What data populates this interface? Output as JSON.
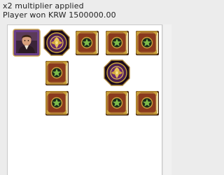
{
  "status": {
    "line1": "x2 multiplier applied",
    "line2": "Player won KRW 1500000.00"
  },
  "grid": {
    "rows": 3,
    "columns": 5,
    "cells": [
      [
        {
          "symbol": "portrait-wild",
          "name": "Portrait"
        },
        {
          "symbol": "medallion",
          "name": "Medallion"
        },
        {
          "symbol": "spellbook",
          "name": "Book"
        },
        {
          "symbol": "spellbook",
          "name": "Book"
        },
        {
          "symbol": "spellbook",
          "name": "Book"
        }
      ],
      [
        null,
        {
          "symbol": "spellbook",
          "name": "Book"
        },
        null,
        {
          "symbol": "medallion",
          "name": "Medallion"
        },
        null
      ],
      [
        null,
        {
          "symbol": "spellbook",
          "name": "Book"
        },
        null,
        {
          "symbol": "spellbook",
          "name": "Book"
        },
        {
          "symbol": "spellbook",
          "name": "Book"
        }
      ]
    ]
  },
  "colors": {
    "page_background": "#ececec",
    "panel_background": "#ffffff",
    "book_cover": "#8a3a1e",
    "book_gold": "#c9a43a",
    "medallion_purple": "#4a1f4f",
    "portrait_frame": "#6a3f8a"
  }
}
